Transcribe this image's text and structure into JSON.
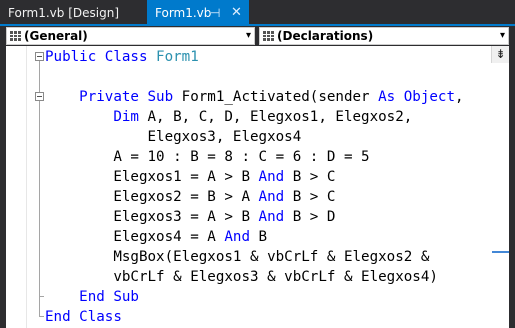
{
  "tabs": [
    {
      "label": "Form1.vb [Design]",
      "active": false
    },
    {
      "label": "Form1.vb",
      "active": true
    }
  ],
  "tab_icons": {
    "pin": "pin-icon",
    "close": "close-icon"
  },
  "tab_glyphs": {
    "pin": "⊣",
    "close": "✕"
  },
  "navigation": {
    "class_combo": {
      "value": "(General)",
      "icon": "class-icon"
    },
    "member_combo": {
      "value": "(Declarations)",
      "icon": "members-icon"
    },
    "chevron": "▾"
  },
  "splitter_glyph": "⇟",
  "code_lines": [
    [
      {
        "t": "Public Class ",
        "c": "kw"
      },
      {
        "t": "Form1",
        "c": "ty"
      }
    ],
    [],
    [
      {
        "t": "    Private Sub ",
        "c": "kw"
      },
      {
        "t": "Form1_Activated(sender ",
        "c": ""
      },
      {
        "t": "As ",
        "c": "kw"
      },
      {
        "t": "Object",
        "c": "kw"
      },
      {
        "t": ",",
        "c": ""
      }
    ],
    [
      {
        "t": "        Dim ",
        "c": "kw"
      },
      {
        "t": "A, B, C, D, Elegxos1, Elegxos2,",
        "c": ""
      }
    ],
    [
      {
        "t": "            Elegxos3, Elegxos4",
        "c": ""
      }
    ],
    [
      {
        "t": "        A = 10 : B = 8 : C = 6 : D = 5",
        "c": ""
      }
    ],
    [
      {
        "t": "        Elegxos1 = A > B ",
        "c": ""
      },
      {
        "t": "And",
        "c": "kw"
      },
      {
        "t": " B > C",
        "c": ""
      }
    ],
    [
      {
        "t": "        Elegxos2 = B > A ",
        "c": ""
      },
      {
        "t": "And",
        "c": "kw"
      },
      {
        "t": " B > C",
        "c": ""
      }
    ],
    [
      {
        "t": "        Elegxos3 = A > B ",
        "c": ""
      },
      {
        "t": "And",
        "c": "kw"
      },
      {
        "t": " B > D",
        "c": ""
      }
    ],
    [
      {
        "t": "        Elegxos4 = A ",
        "c": ""
      },
      {
        "t": "And",
        "c": "kw"
      },
      {
        "t": " B",
        "c": ""
      }
    ],
    [
      {
        "t": "        MsgBox(Elegxos1 & vbCrLf & Elegxos2 &",
        "c": ""
      }
    ],
    [
      {
        "t": "        vbCrLf & Elegxos3 & vbCrLf & Elegxos4)",
        "c": ""
      }
    ],
    [
      {
        "t": "    End Sub",
        "c": "kw"
      }
    ],
    [
      {
        "t": "End Class",
        "c": "kw"
      }
    ]
  ]
}
